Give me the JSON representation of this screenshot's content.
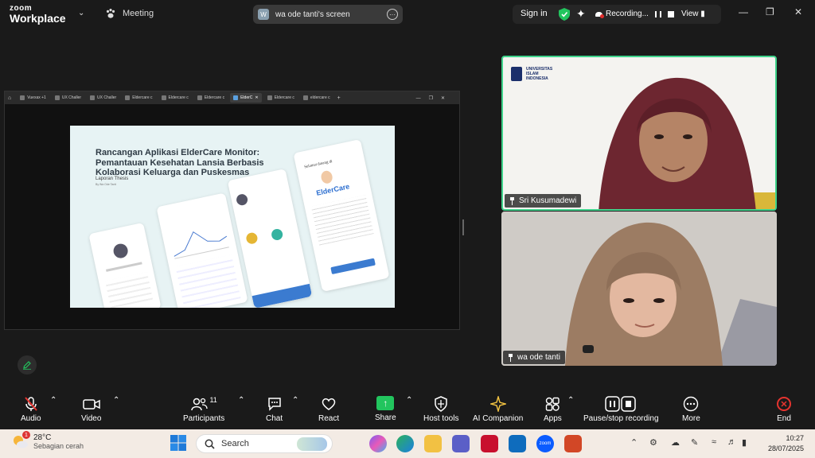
{
  "app": {
    "brand_top": "zoom",
    "brand_bottom": "Workplace",
    "meeting_label": "Meeting",
    "screen_label": "wa ode tanti's screen",
    "screen_avatar": "W",
    "signin": "Sign in",
    "recording": "Recording...",
    "view": "View",
    "accent_green": "#22c55e",
    "end_red": "#e5342f"
  },
  "browser_tabs": [
    "Vuexax +1",
    "UX Challer",
    "UX Challer",
    "Eldercare c",
    "Eldercare c",
    "Eldercare c",
    "ElderC",
    "Eldercare c",
    "eldercare c"
  ],
  "slide": {
    "title": "Rancangan Aplikasi ElderCare Monitor: Pemantauan Kesehatan Lansia Berbasis Kolaborasi Keluarga dan Puskesmas",
    "subtitle": "Laporan Thesis",
    "byline": "By Wa Ode Tanti",
    "app_name": "ElderCare",
    "welcome": "Selamat datang di"
  },
  "participants_tiles": [
    {
      "name": "Sri Kusumadewi",
      "org_line1": "UNIVERSITAS",
      "org_line2": "ISLAM",
      "org_line3": "INDONESIA"
    },
    {
      "name": "wa ode tanti"
    }
  ],
  "toolbar": {
    "audio": "Audio",
    "video": "Video",
    "participants": "Participants",
    "participants_count": "11",
    "chat": "Chat",
    "react": "React",
    "share": "Share",
    "host_tools": "Host tools",
    "ai_companion": "AI Companion",
    "apps": "Apps",
    "pause_stop": "Pause/stop recording",
    "more": "More",
    "end": "End"
  },
  "taskbar": {
    "temp": "28°C",
    "weather_desc": "Sebagian cerah",
    "weather_badge": "1",
    "search_placeholder": "Search",
    "time": "10:27",
    "date": "28/07/2025"
  }
}
